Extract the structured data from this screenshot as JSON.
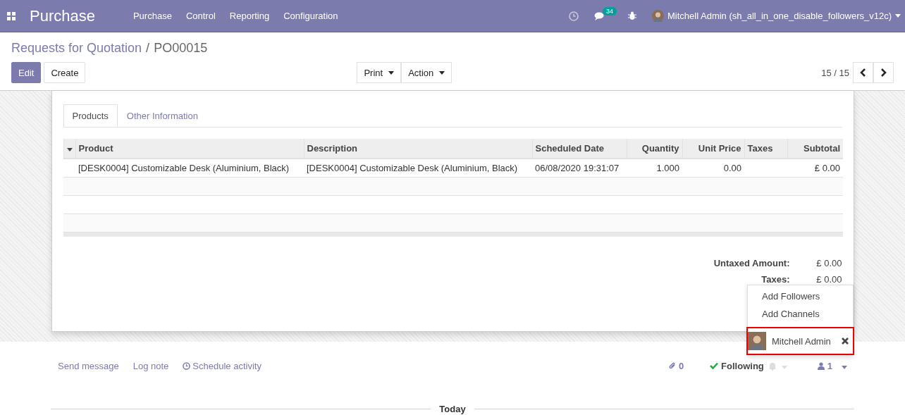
{
  "navbar": {
    "app_name": "Purchase",
    "menu": [
      "Purchase",
      "Control",
      "Reporting",
      "Configuration"
    ],
    "message_count": "34",
    "user": "Mitchell Admin (sh_all_in_one_disable_followers_v12c)"
  },
  "breadcrumb": {
    "parent": "Requests for Quotation",
    "separator": "/",
    "current": "PO00015"
  },
  "buttons": [
    {
      "label": "Edit",
      "kind": "primary"
    },
    {
      "label": "Create",
      "kind": "secondary"
    }
  ],
  "dropdowns": [
    "Print",
    "Action"
  ],
  "pager": "15 / 15",
  "tabs": [
    {
      "label": "Products",
      "selected": true
    },
    {
      "label": "Other Information",
      "selected": false
    }
  ],
  "table": {
    "columns": [
      {
        "label": "Product",
        "kind": "text"
      },
      {
        "label": "Description",
        "kind": "text"
      },
      {
        "label": "Scheduled Date",
        "kind": "text"
      },
      {
        "label": "Quantity",
        "kind": "number"
      },
      {
        "label": "Unit Price",
        "kind": "number"
      },
      {
        "label": "Taxes",
        "kind": "text"
      },
      {
        "label": "Subtotal",
        "kind": "number"
      }
    ],
    "rows": [
      [
        "[DESK0004] Customizable Desk (Aluminium, Black)",
        "[DESK0004] Customizable Desk (Aluminium, Black)",
        "06/08/2020 19:31:07",
        "1.000",
        "0.00",
        "",
        "£ 0.00"
      ]
    ]
  },
  "totals": [
    {
      "label": "Untaxed Amount:",
      "value": "£ 0.00"
    },
    {
      "label": "Taxes:",
      "value": "£ 0.00"
    }
  ],
  "chatter": {
    "actions": [
      "Send message",
      "Log note",
      "Schedule activity"
    ],
    "attachments": "0",
    "follow": "Following",
    "followers": "1",
    "divider": "Today"
  },
  "followers_menu": {
    "items": [
      "Add Followers",
      "Add Channels"
    ],
    "follower": "Mitchell Admin"
  }
}
